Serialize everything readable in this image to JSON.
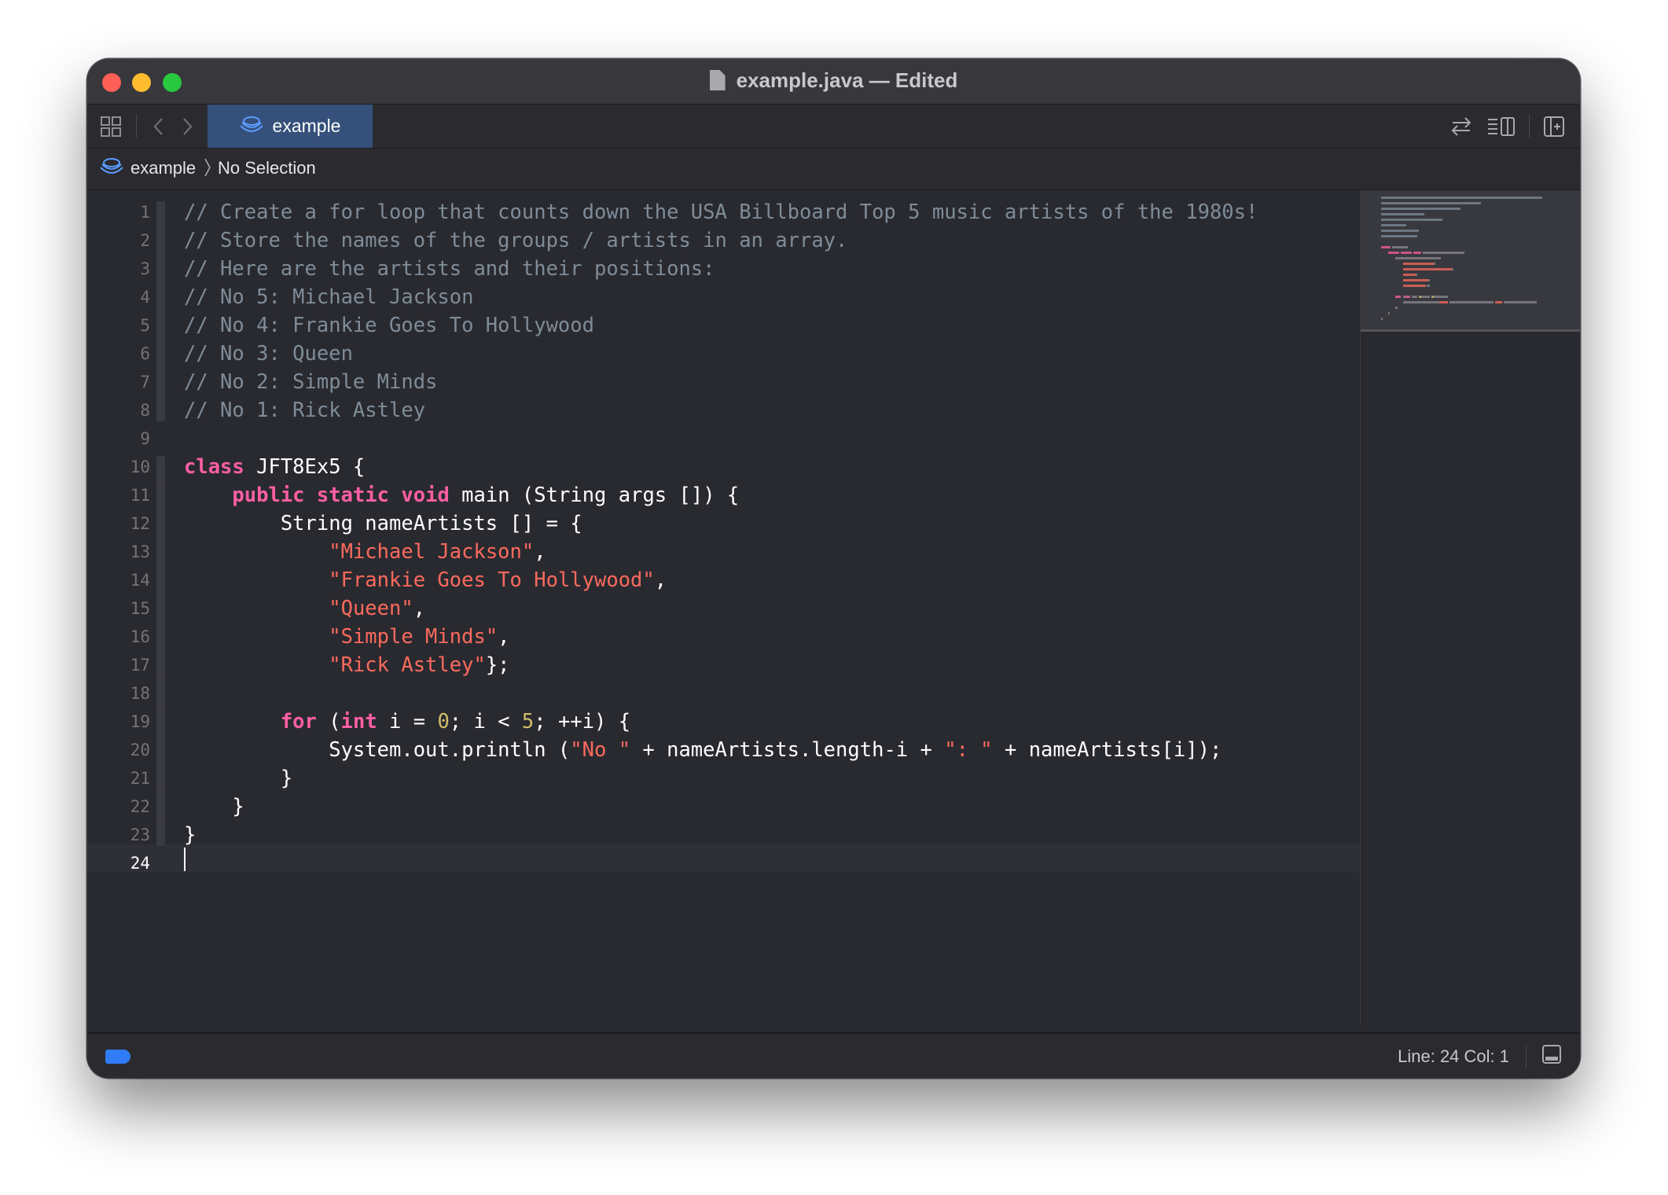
{
  "window": {
    "title": "example.java — Edited"
  },
  "tabs": [
    {
      "label": "example",
      "icon": "package-icon",
      "active": true
    }
  ],
  "jumpbar": {
    "project": "example",
    "selection": "No Selection"
  },
  "editor": {
    "current_line": 24,
    "lines": [
      [
        {
          "t": "// Create a for loop that counts down the USA Billboard Top 5 music artists of the 1980s!",
          "c": "cmt"
        }
      ],
      [
        {
          "t": "// Store the names of the groups / artists in an array.",
          "c": "cmt"
        }
      ],
      [
        {
          "t": "// Here are the artists and their positions:",
          "c": "cmt"
        }
      ],
      [
        {
          "t": "// No 5: Michael Jackson",
          "c": "cmt"
        }
      ],
      [
        {
          "t": "// No 4: Frankie Goes To Hollywood",
          "c": "cmt"
        }
      ],
      [
        {
          "t": "// No 3: Queen",
          "c": "cmt"
        }
      ],
      [
        {
          "t": "// No 2: Simple Minds",
          "c": "cmt"
        }
      ],
      [
        {
          "t": "// No 1: Rick Astley",
          "c": "cmt"
        }
      ],
      [],
      [
        {
          "t": "class",
          "c": "kw"
        },
        {
          "t": " JFT8Ex5 {",
          "c": ""
        }
      ],
      [
        {
          "t": "    ",
          "c": ""
        },
        {
          "t": "public",
          "c": "kw"
        },
        {
          "t": " ",
          "c": ""
        },
        {
          "t": "static",
          "c": "kw"
        },
        {
          "t": " ",
          "c": ""
        },
        {
          "t": "void",
          "c": "kw"
        },
        {
          "t": " main (String args []) {",
          "c": ""
        }
      ],
      [
        {
          "t": "        String nameArtists [] = {",
          "c": ""
        }
      ],
      [
        {
          "t": "            ",
          "c": ""
        },
        {
          "t": "\"Michael Jackson\"",
          "c": "str"
        },
        {
          "t": ",",
          "c": ""
        }
      ],
      [
        {
          "t": "            ",
          "c": ""
        },
        {
          "t": "\"Frankie Goes To Hollywood\"",
          "c": "str"
        },
        {
          "t": ",",
          "c": ""
        }
      ],
      [
        {
          "t": "            ",
          "c": ""
        },
        {
          "t": "\"Queen\"",
          "c": "str"
        },
        {
          "t": ",",
          "c": ""
        }
      ],
      [
        {
          "t": "            ",
          "c": ""
        },
        {
          "t": "\"Simple Minds\"",
          "c": "str"
        },
        {
          "t": ",",
          "c": ""
        }
      ],
      [
        {
          "t": "            ",
          "c": ""
        },
        {
          "t": "\"Rick Astley\"",
          "c": "str"
        },
        {
          "t": "};",
          "c": ""
        }
      ],
      [],
      [
        {
          "t": "        ",
          "c": ""
        },
        {
          "t": "for",
          "c": "kw"
        },
        {
          "t": " (",
          "c": ""
        },
        {
          "t": "int",
          "c": "kw"
        },
        {
          "t": " i = ",
          "c": ""
        },
        {
          "t": "0",
          "c": "num"
        },
        {
          "t": "; i < ",
          "c": ""
        },
        {
          "t": "5",
          "c": "num"
        },
        {
          "t": "; ++i) {",
          "c": ""
        }
      ],
      [
        {
          "t": "            System.out.println (",
          "c": ""
        },
        {
          "t": "\"No \"",
          "c": "str"
        },
        {
          "t": " + nameArtists.length-i + ",
          "c": ""
        },
        {
          "t": "\": \"",
          "c": "str"
        },
        {
          "t": " + nameArtists[i]);",
          "c": ""
        }
      ],
      [
        {
          "t": "        }",
          "c": ""
        }
      ],
      [
        {
          "t": "    }",
          "c": ""
        }
      ],
      [
        {
          "t": "}",
          "c": ""
        }
      ],
      []
    ]
  },
  "status": {
    "position": "Line: 24  Col: 1"
  },
  "colors": {
    "comment": "#7f8c98",
    "keyword": "#fc5fa3",
    "string": "#fc6a5d",
    "number": "#d0bf69",
    "tab_active": "#35507a",
    "accent": "#2f7cf6"
  }
}
